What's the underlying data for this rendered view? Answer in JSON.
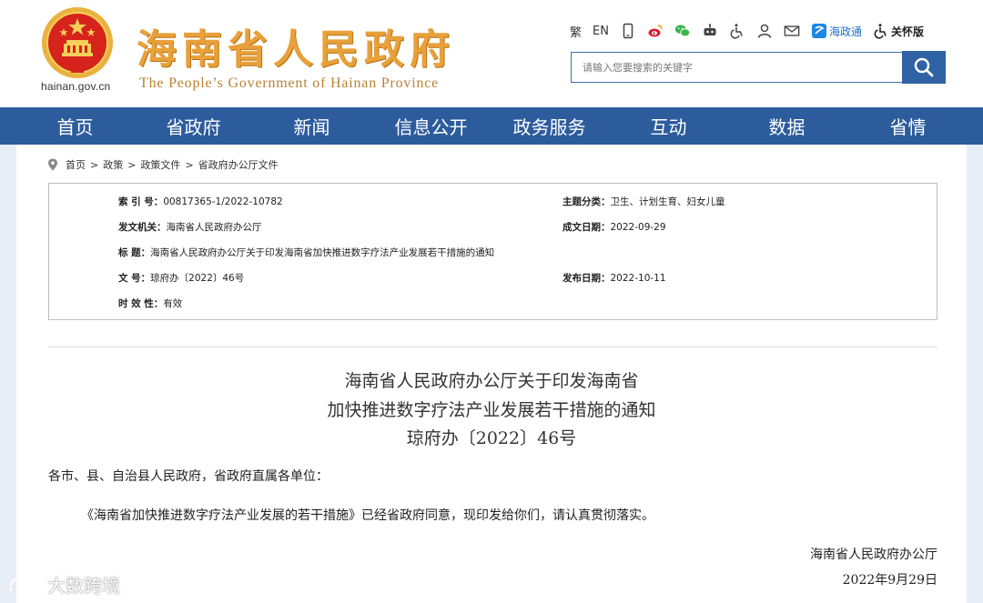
{
  "header": {
    "domain": "hainan.gov.cn",
    "title": "海南省人民政府",
    "subtitle": "The People’s Government  of Hainan Province"
  },
  "toolbar": {
    "traditional": "繁",
    "english": "EN",
    "hainan_app": "海政通",
    "care_mode": "关怀版"
  },
  "search": {
    "placeholder": "请输入您要搜索的关键字"
  },
  "nav": [
    "首页",
    "省政府",
    "新闻",
    "信息公开",
    "政务服务",
    "互动",
    "数据",
    "省情"
  ],
  "breadcrumb": [
    "首页",
    "政策",
    "政策文件",
    "省政府办公厅文件"
  ],
  "info": {
    "index_label": "索 引 号：",
    "index_value": "00817365-1/2022-10782",
    "topic_label": "主题分类：",
    "topic_value": "卫生、计划生育、妇女儿童",
    "issuer_label": "发文机关：",
    "issuer_value": "海南省人民政府办公厅",
    "created_label": "成文日期：",
    "created_value": "2022-09-29",
    "title_label": "标    题：",
    "title_value": "海南省人民政府办公厅关于印发海南省加快推进数字疗法产业发展若干措施的通知",
    "docno_label": "文    号：",
    "docno_value": "琼府办〔2022〕46号",
    "published_label": "发布日期：",
    "published_value": "2022-10-11",
    "validity_label": "时 效 性：",
    "validity_value": "有效"
  },
  "document": {
    "title_line1": "海南省人民政府办公厅关于印发海南省",
    "title_line2": "加快推进数字疗法产业发展若干措施的通知",
    "doc_number": "琼府办〔2022〕46号",
    "greeting": "各市、县、自治县人民政府，省政府直属各单位：",
    "paragraph": "《海南省加快推进数字疗法产业发展的若干措施》已经省政府同意，现印发给你们，请认真贯彻落实。",
    "signer": "海南省人民政府办公厅",
    "date": "2022年9月29日"
  },
  "watermark": {
    "text": "大数跨境"
  },
  "colors": {
    "nav_blue": "#2d5c9d",
    "title_gold": "#e8a13a",
    "emblem_red": "#d6231c"
  }
}
